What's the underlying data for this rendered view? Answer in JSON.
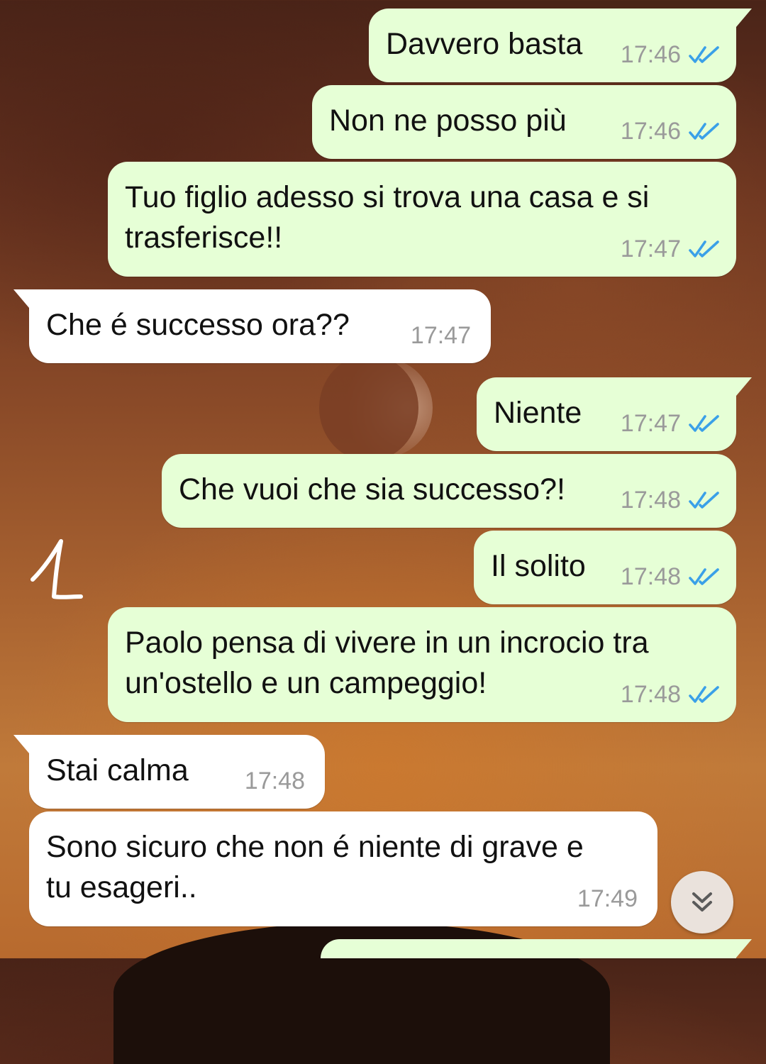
{
  "chat": {
    "messages": [
      {
        "direction": "outgoing",
        "text": "Davvero basta",
        "time": "17:46",
        "status": "read"
      },
      {
        "direction": "outgoing",
        "text": "Non ne posso più",
        "time": "17:46",
        "status": "read"
      },
      {
        "direction": "outgoing",
        "text": "Tuo figlio adesso si trova una casa e si\ntrasferisce!!",
        "time": "17:47",
        "status": "read"
      },
      {
        "direction": "incoming",
        "text": "Che é successo ora??",
        "time": "17:47"
      },
      {
        "direction": "outgoing",
        "text": "Niente",
        "time": "17:47",
        "status": "read"
      },
      {
        "direction": "outgoing",
        "text": "Che vuoi che sia successo?!",
        "time": "17:48",
        "status": "read"
      },
      {
        "direction": "outgoing",
        "text": "Il solito",
        "time": "17:48",
        "status": "read"
      },
      {
        "direction": "outgoing",
        "text": "Paolo pensa di vivere in un incrocio tra\nun'ostello e un campeggio!",
        "time": "17:48",
        "status": "read"
      },
      {
        "direction": "incoming",
        "text": "Stai calma",
        "time": "17:48"
      },
      {
        "direction": "incoming",
        "text": "Sono sicuro che non é niente di grave e\ntu esageri..",
        "time": "17:49"
      }
    ]
  },
  "annotation": {
    "number": "1"
  },
  "icons": {
    "read_ticks": "double-check-icon",
    "scroll_down": "double-chevron-down-icon"
  },
  "colors": {
    "outgoing_bubble": "#e6ffd6",
    "incoming_bubble": "#ffffff",
    "read_ticks": "#3aa0e8",
    "timestamp": "#9a9a9a",
    "scroll_button": "#eae2dc"
  }
}
